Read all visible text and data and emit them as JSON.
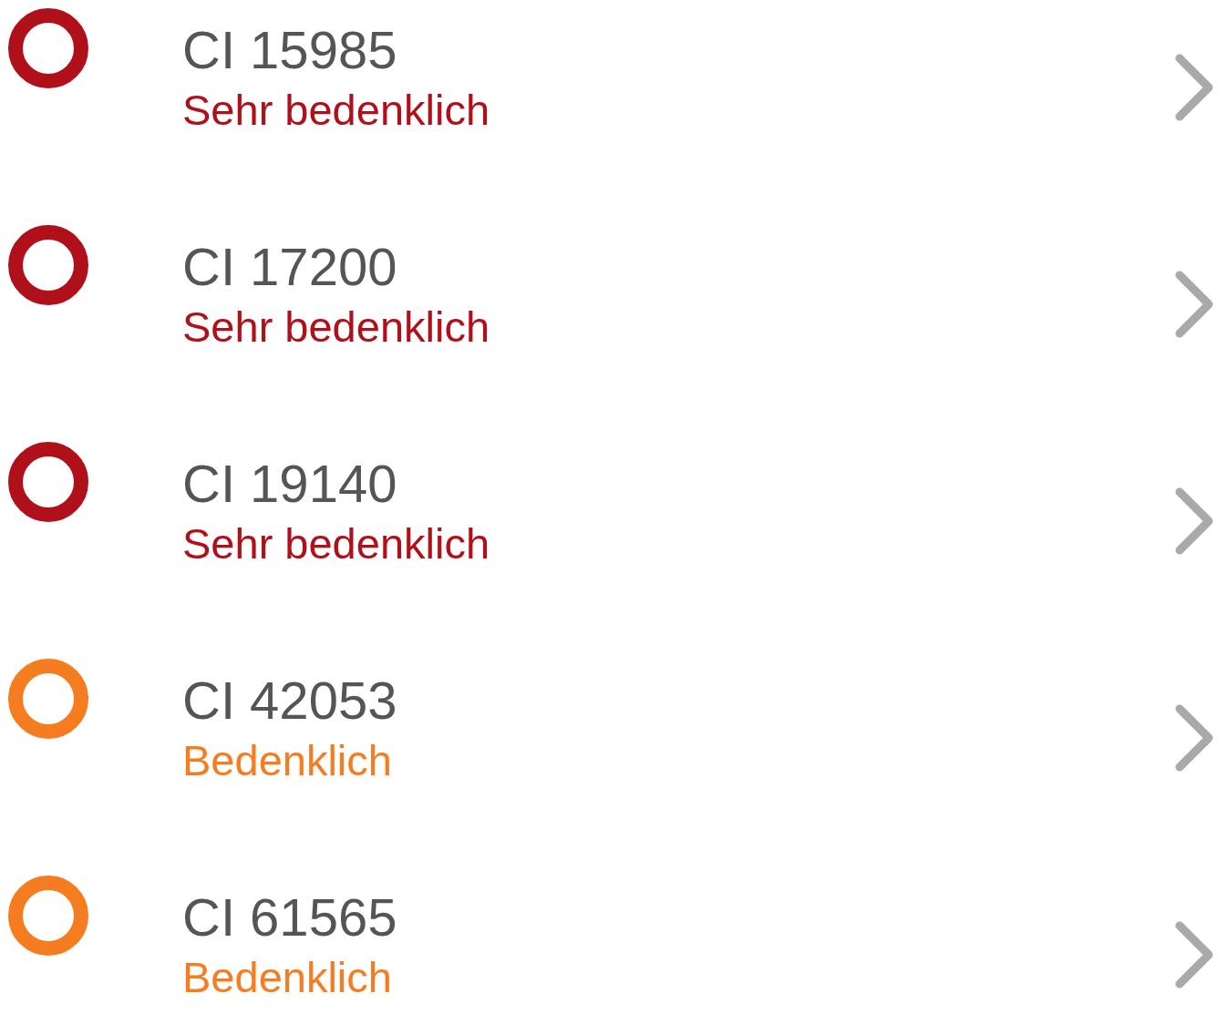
{
  "items": [
    {
      "title": "CI 15985",
      "status": "Sehr bedenklich",
      "color": "#b0101a"
    },
    {
      "title": "CI 17200",
      "status": "Sehr bedenklich",
      "color": "#b0101a"
    },
    {
      "title": "CI 19140",
      "status": "Sehr bedenklich",
      "color": "#b0101a"
    },
    {
      "title": "CI 42053",
      "status": "Bedenklich",
      "color": "#f57c1f"
    },
    {
      "title": "CI 61565",
      "status": "Bedenklich",
      "color": "#f57c1f"
    }
  ]
}
